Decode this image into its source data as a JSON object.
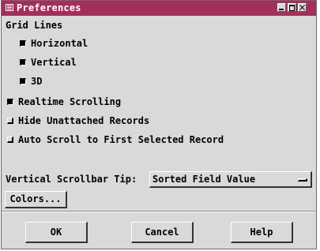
{
  "window": {
    "title": "Preferences"
  },
  "grid_lines": {
    "label": "Grid Lines",
    "options": [
      {
        "label": "Horizontal",
        "checked": true
      },
      {
        "label": "Vertical",
        "checked": true
      },
      {
        "label": "3D",
        "checked": true
      }
    ]
  },
  "options": [
    {
      "label": "Realtime Scrolling",
      "checked": true
    },
    {
      "label": "Hide Unattached Records",
      "checked": false
    },
    {
      "label": "Auto Scroll to First Selected Record",
      "checked": false
    }
  ],
  "scrollbar_tip": {
    "label": "Vertical Scrollbar Tip:",
    "value": "Sorted Field Value"
  },
  "colors_button": "Colors...",
  "actions": {
    "ok": "OK",
    "cancel": "Cancel",
    "help": "Help"
  },
  "colors": {
    "titlebar": "#a3305a",
    "dialog_bg": "#d9d9d9"
  }
}
